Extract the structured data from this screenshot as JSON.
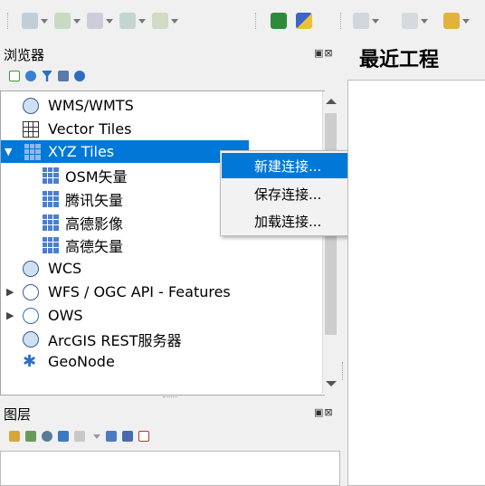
{
  "toolbar": {
    "buttons": [
      "new-layer-icon",
      "add-vector-icon",
      "add-raster-icon",
      "add-db-icon",
      "add-web-icon",
      "zoom-identify-icon",
      "measure-icon",
      "select-icon",
      "attribute-table-icon",
      "edit-style-icon"
    ]
  },
  "browser": {
    "title": "浏览器",
    "float_close": "▣⊠",
    "items": [
      {
        "label": "WMS/WMTS",
        "icon": "globe-icon"
      },
      {
        "label": "Vector Tiles",
        "icon": "grid-icon"
      },
      {
        "label": "XYZ Tiles",
        "icon": "tiles-icon",
        "expanded": true,
        "selected": true
      },
      {
        "label": "OSM矢量",
        "icon": "tiles-icon"
      },
      {
        "label": "腾讯矢量",
        "icon": "tiles-icon"
      },
      {
        "label": "高德影像",
        "icon": "tiles-icon"
      },
      {
        "label": "高德矢量",
        "icon": "tiles-icon"
      },
      {
        "label": "WCS",
        "icon": "globe-icon"
      },
      {
        "label": "WFS / OGC API - Features",
        "icon": "globe-icon"
      },
      {
        "label": "OWS",
        "icon": "globe-icon"
      },
      {
        "label": "ArcGIS REST服务器",
        "icon": "globe-icon"
      },
      {
        "label": "GeoNode",
        "icon": "geonode-icon"
      }
    ]
  },
  "context_menu": {
    "items": [
      "新建连接...",
      "保存连接...",
      "加载连接..."
    ]
  },
  "recent": {
    "title": "最近工程"
  },
  "layers": {
    "title": "图层",
    "float_close": "▣⊠"
  },
  "colors": {
    "selection": "#0078d7",
    "panel_bg": "#f0f0f0"
  }
}
